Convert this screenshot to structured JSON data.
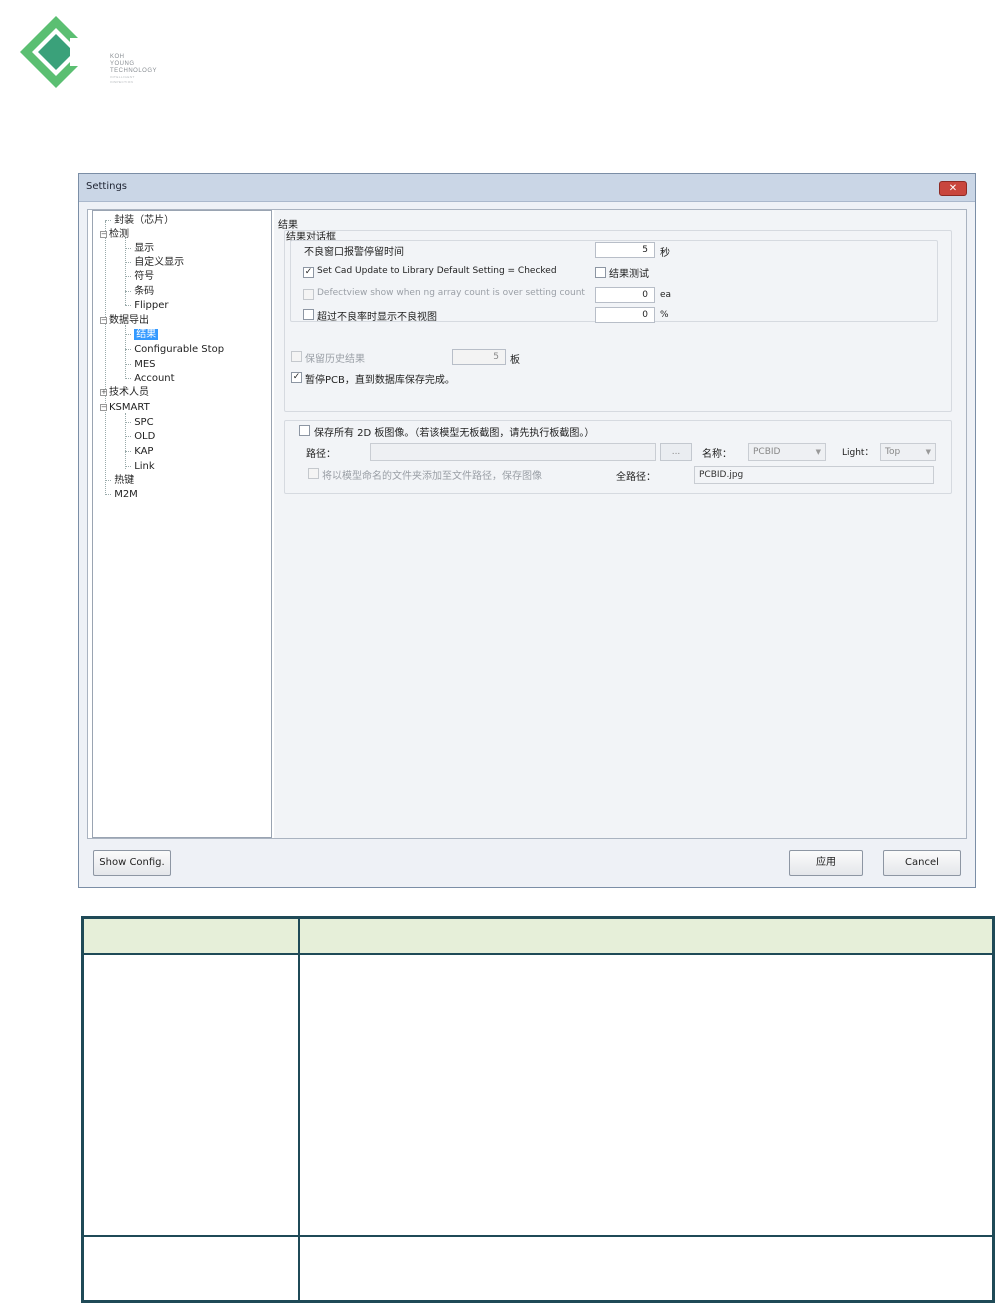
{
  "logo": {
    "line1": "KOH",
    "line2": "YOUNG",
    "line3": "TECHNOLOGY",
    "line4": "INTELLIGENT",
    "line5": "INSPECTION",
    "colors": {
      "green": "#5bbf72",
      "teal": "#3aa17a",
      "dark": "#5a6368"
    }
  },
  "dialog": {
    "title": "Settings",
    "close_label": "✕",
    "tree": {
      "items": [
        {
          "label": "封装（芯片）",
          "expander": ""
        },
        {
          "label": "检测",
          "expander": "−"
        },
        {
          "label": "显示",
          "expander": ""
        },
        {
          "label": "自定义显示",
          "expander": ""
        },
        {
          "label": "符号",
          "expander": ""
        },
        {
          "label": "条码",
          "expander": ""
        },
        {
          "label": "Flipper",
          "expander": ""
        },
        {
          "label": "数据导出",
          "expander": "−"
        },
        {
          "label": "结果",
          "expander": ""
        },
        {
          "label": "Configurable Stop",
          "expander": ""
        },
        {
          "label": "MES",
          "expander": ""
        },
        {
          "label": "Account",
          "expander": ""
        },
        {
          "label": "技术人员",
          "expander": "+"
        },
        {
          "label": "KSMART",
          "expander": "−"
        },
        {
          "label": "SPC",
          "expander": ""
        },
        {
          "label": "OLD",
          "expander": ""
        },
        {
          "label": "KAP",
          "expander": ""
        },
        {
          "label": "Link",
          "expander": ""
        },
        {
          "label": "热键",
          "expander": ""
        },
        {
          "label": "M2M",
          "expander": ""
        }
      ]
    },
    "pane": {
      "section_title": "结果",
      "dialog_group_title": "结果对话框",
      "ng_window_pause_label": "不良窗口报警停留时间",
      "ng_window_pause_value": "5",
      "ng_window_pause_unit": "秒",
      "cad_update_label": "Set Cad Update to Library Default Setting = Checked",
      "cad_update_checked": "✓",
      "result_test_label": "结果测试",
      "defectview_label": "Defectview show when ng array count is over setting count",
      "defectview_value": "0",
      "defectview_unit": "ea",
      "exceed_rate_label": "超过不良率时显示不良视图",
      "exceed_rate_value": "0",
      "exceed_rate_unit": "%",
      "keep_history_label": "保留历史结果",
      "keep_history_value": "5",
      "keep_history_unit": "板",
      "pause_pcb_label": "暂停PCB，直到数据库保存完成。",
      "pause_pcb_checked": "✓",
      "save_2d_label": "保存所有 2D 板图像。（若该模型无板截图，请先执行板截图。）",
      "path_label": "路径：",
      "path_value": "",
      "browse_label": "...",
      "name_label": "名称：",
      "name_value": "PCBID",
      "light_label": "Light：",
      "light_value": "Top",
      "model_folder_label": "将以模型命名的文件夹添加至文件路径，保存图像",
      "full_path_label": "全路径：",
      "full_path_value": "PCBID.jpg"
    },
    "buttons": {
      "show_config": "Show Config.",
      "apply": "应用",
      "cancel": "Cancel"
    }
  },
  "table": {
    "headers": [
      "",
      ""
    ],
    "rows": [
      [
        "",
        ""
      ],
      [
        "",
        ""
      ]
    ]
  }
}
